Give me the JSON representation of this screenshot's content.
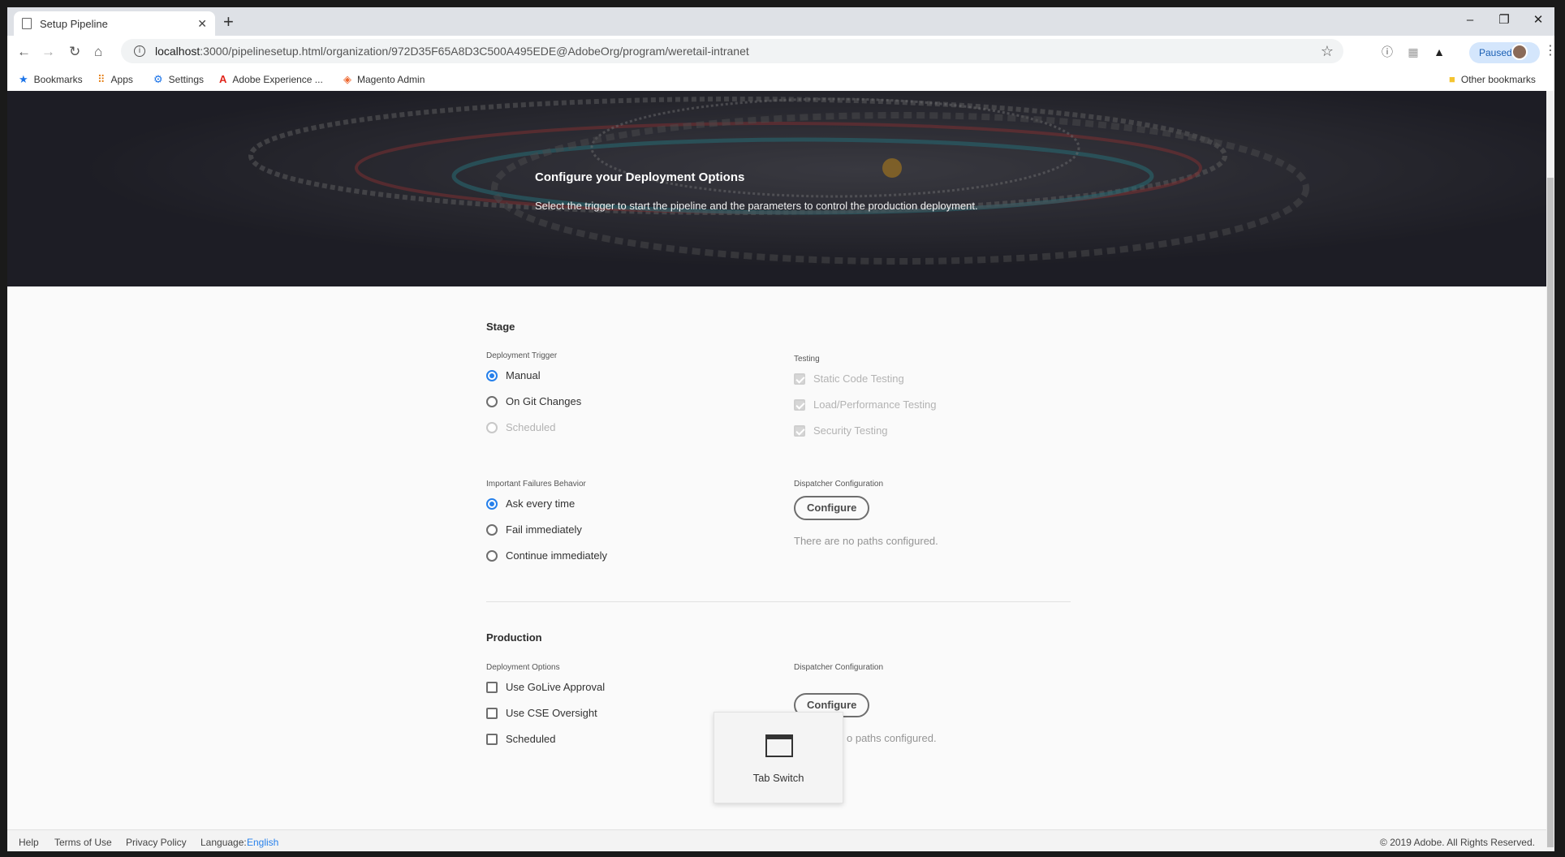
{
  "browser": {
    "tab_title": "Setup Pipeline",
    "url_host": "localhost",
    "url_rest": ":3000/pipelinesetup.html/organization/972D35F65A8D3C500A495EDE@AdobeOrg/program/weretail-intranet",
    "profile_status": "Paused",
    "bookmarks": [
      {
        "label": "Bookmarks",
        "icon": "star-icon"
      },
      {
        "label": "Apps",
        "icon": "apps-grid-icon"
      },
      {
        "label": "Settings",
        "icon": "gear-icon"
      },
      {
        "label": "Adobe Experience ...",
        "icon": "adobe-icon"
      },
      {
        "label": "Magento Admin",
        "icon": "magento-icon"
      }
    ],
    "other_bookmarks": "Other bookmarks"
  },
  "hero": {
    "title": "Configure your Deployment Options",
    "subtitle": "Select the trigger to start the pipeline and the parameters to control the production deployment."
  },
  "stage": {
    "title": "Stage",
    "deployment_trigger_label": "Deployment Trigger",
    "triggers": [
      "Manual",
      "On Git Changes",
      "Scheduled"
    ],
    "testing_label": "Testing",
    "tests": [
      "Static Code Testing",
      "Load/Performance Testing",
      "Security Testing"
    ],
    "failures_label": "Important Failures Behavior",
    "failures": [
      "Ask every time",
      "Fail immediately",
      "Continue immediately"
    ],
    "dispatcher_label": "Dispatcher Configuration",
    "configure_label": "Configure",
    "no_paths": "There are no paths configured."
  },
  "production": {
    "title": "Production",
    "options_label": "Deployment Options",
    "options": [
      "Use GoLive Approval",
      "Use CSE Oversight",
      "Scheduled"
    ],
    "dispatcher_label": "Dispatcher Configuration",
    "configure_label": "Configure",
    "no_paths_partial": "o paths configured."
  },
  "footer": {
    "help": "Help",
    "terms": "Terms of Use",
    "privacy": "Privacy Policy",
    "language_label": "Language:",
    "language_value": "English",
    "copyright": "© 2019 Adobe. All Rights Reserved."
  },
  "overlay": {
    "label": "Tab Switch"
  }
}
